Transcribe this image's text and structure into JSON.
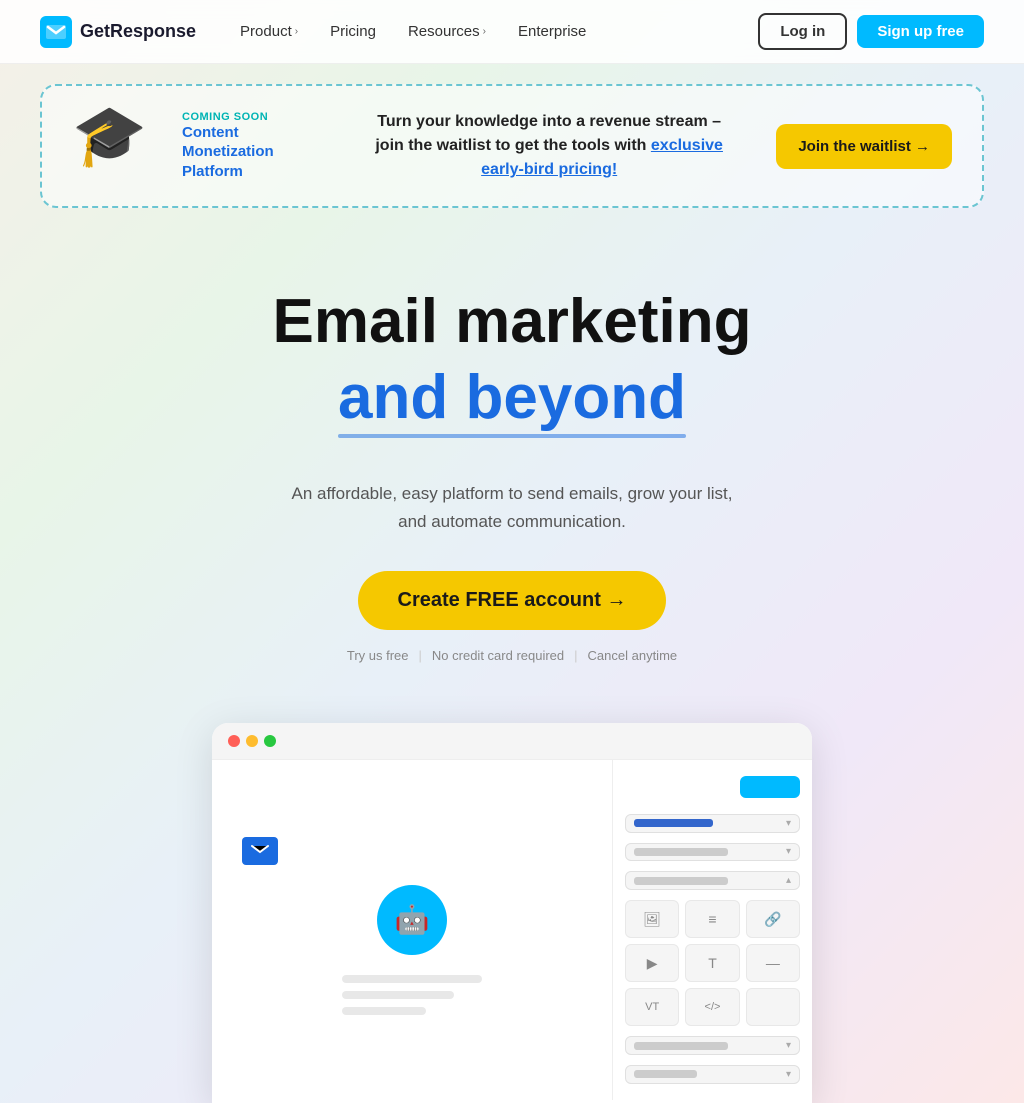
{
  "nav": {
    "logo_text": "GetResponse",
    "links": [
      {
        "label": "Product",
        "has_arrow": true
      },
      {
        "label": "Pricing",
        "has_arrow": false
      },
      {
        "label": "Resources",
        "has_arrow": true
      },
      {
        "label": "Enterprise",
        "has_arrow": false
      }
    ],
    "login_label": "Log in",
    "signup_label": "Sign up free"
  },
  "banner": {
    "coming_soon": "COMING SOON",
    "platform_title": "Content\nMonetization\nPlatform",
    "main_text": "Turn your knowledge into a revenue stream –\njoin the waitlist to get the tools with ",
    "link_text": "exclusive\nearly-bird pricing!",
    "cta_label": "Join the waitlist →"
  },
  "hero": {
    "title_line1": "Email marketing",
    "title_line2": "and beyond",
    "description": "An affordable, easy platform to send emails, grow your list,\nand automate communication.",
    "cta_label": "Create FREE account →",
    "note_items": [
      "Try us free",
      "No credit card required",
      "Cancel anytime"
    ]
  },
  "app_preview": {
    "grid_icons": [
      "🖼",
      "≡",
      "🔗",
      "▶",
      "T",
      "—",
      "VT",
      "</>"
    ]
  }
}
